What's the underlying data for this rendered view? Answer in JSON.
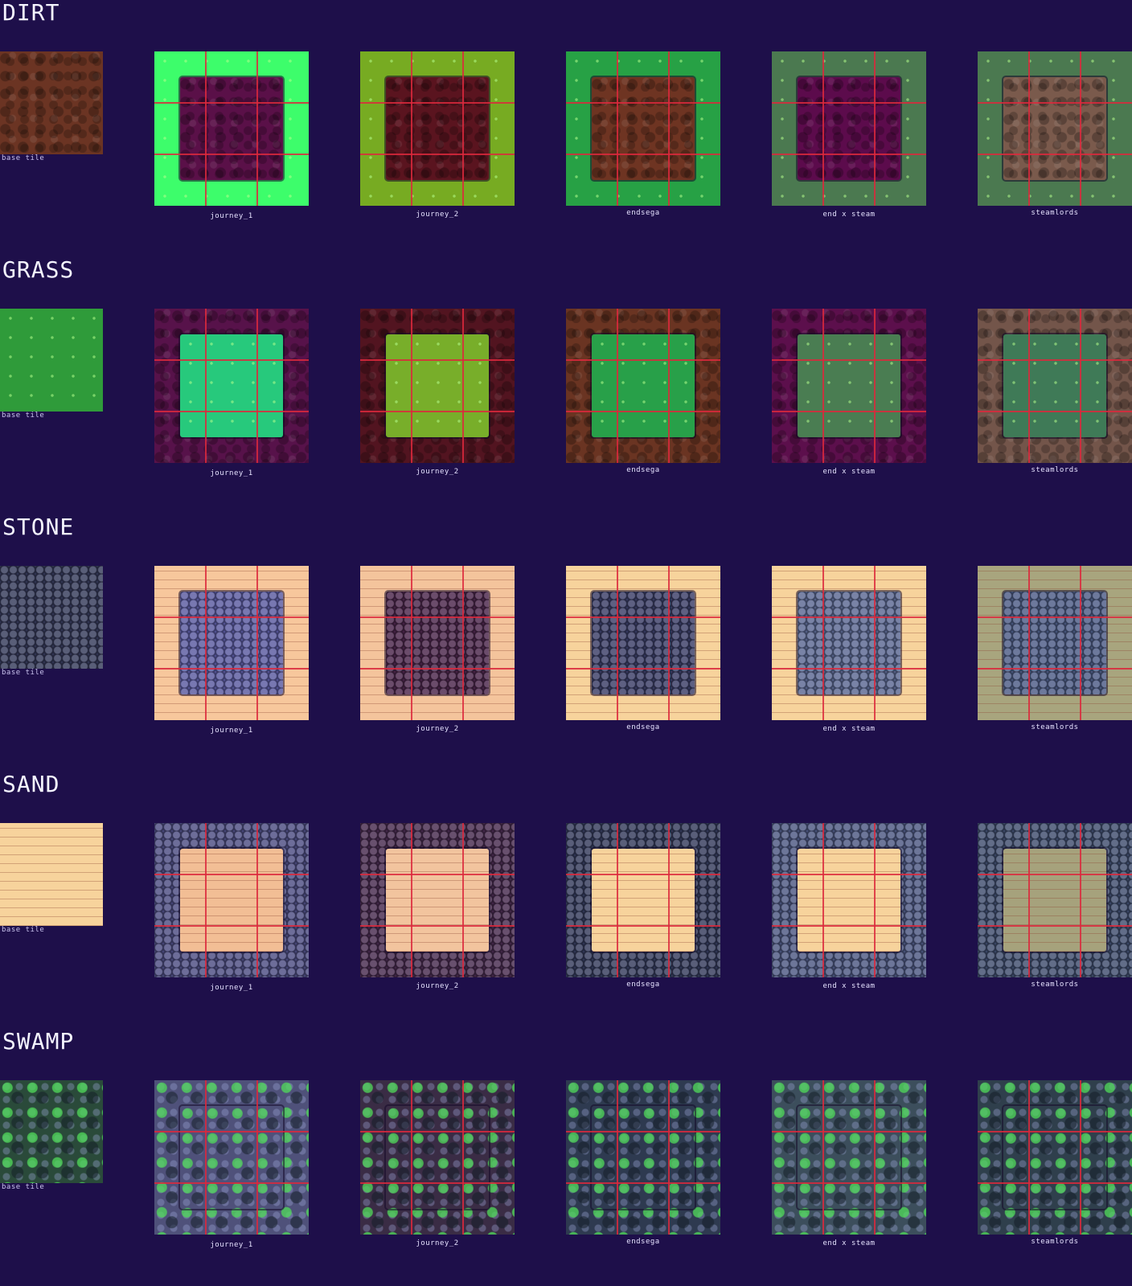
{
  "sections": [
    {
      "title": "DIRT",
      "base_label": "base tile",
      "base": {
        "fill": "#6b3423",
        "texture": "dirt"
      },
      "variants": [
        {
          "label": "journey_1",
          "outer": "#3dfd6b",
          "outer_tex": "grass",
          "inner": "#5a1048",
          "inner_tex": "dirt"
        },
        {
          "label": "journey_2",
          "outer": "#77ab22",
          "outer_tex": "grass",
          "inner": "#5a141f",
          "inner_tex": "dirt"
        },
        {
          "label": "endsega",
          "outer": "#27a145",
          "outer_tex": "grass",
          "inner": "#6e3422",
          "inner_tex": "dirt"
        },
        {
          "label": "end x steam",
          "outer": "#4b7950",
          "outer_tex": "grass",
          "inner": "#5c0b4c",
          "inner_tex": "dirt"
        },
        {
          "label": "steamlords",
          "outer": "#4b7950",
          "outer_tex": "grass",
          "inner": "#7a5a4c",
          "inner_tex": "dirt"
        }
      ]
    },
    {
      "title": "GRASS",
      "base_label": "base tile",
      "base": {
        "fill": "#2f9b3a",
        "texture": "grass"
      },
      "variants": [
        {
          "label": "journey_1",
          "outer": "#57124a",
          "outer_tex": "dirt",
          "inner": "#27c97c",
          "inner_tex": "grass"
        },
        {
          "label": "journey_2",
          "outer": "#521420",
          "outer_tex": "dirt",
          "inner": "#78ae2a",
          "inner_tex": "grass"
        },
        {
          "label": "endsega",
          "outer": "#6a3422",
          "outer_tex": "dirt",
          "inner": "#28a049",
          "inner_tex": "grass"
        },
        {
          "label": "end x steam",
          "outer": "#5c0f4c",
          "outer_tex": "dirt",
          "inner": "#4a7d52",
          "inner_tex": "grass"
        },
        {
          "label": "steamlords",
          "outer": "#73554a",
          "outer_tex": "dirt",
          "inner": "#3f7a57",
          "inner_tex": "grass"
        }
      ]
    },
    {
      "title": "STONE",
      "base_label": "base tile",
      "base": {
        "fill": "#353a5a",
        "texture": "stone"
      },
      "variants": [
        {
          "label": "journey_1",
          "outer": "#f7c79c",
          "outer_tex": "sand",
          "inner": "#5a5aa0",
          "inner_tex": "stone"
        },
        {
          "label": "journey_2",
          "outer": "#f4c49c",
          "outer_tex": "sand",
          "inner": "#4a254a",
          "inner_tex": "stone"
        },
        {
          "label": "endsega",
          "outer": "#f7d39c",
          "outer_tex": "sand",
          "inner": "#3a3d66",
          "inner_tex": "stone"
        },
        {
          "label": "end x steam",
          "outer": "#f7d39c",
          "outer_tex": "sand",
          "inner": "#5b6892",
          "inner_tex": "stone"
        },
        {
          "label": "steamlords",
          "outer": "#a8a57e",
          "outer_tex": "sand",
          "inner": "#4d5c86",
          "inner_tex": "stone"
        }
      ]
    },
    {
      "title": "SAND",
      "base_label": "base tile",
      "base": {
        "fill": "#f7d39c",
        "texture": "sand"
      },
      "variants": [
        {
          "label": "journey_1",
          "outer": "#4d4d82",
          "outer_tex": "stone",
          "inner": "#f2be95",
          "inner_tex": "sand"
        },
        {
          "label": "journey_2",
          "outer": "#472a4e",
          "outer_tex": "stone",
          "inner": "#f2c49e",
          "inner_tex": "sand"
        },
        {
          "label": "endsega",
          "outer": "#343b5c",
          "outer_tex": "stone",
          "inner": "#f7d39c",
          "inner_tex": "sand"
        },
        {
          "label": "end x steam",
          "outer": "#4d5882",
          "outer_tex": "stone",
          "inner": "#f7d39c",
          "inner_tex": "sand"
        },
        {
          "label": "steamlords",
          "outer": "#3f4d6e",
          "outer_tex": "stone",
          "inner": "#a6a27c",
          "inner_tex": "sand"
        }
      ]
    },
    {
      "title": "SWAMP",
      "base_label": "base tile",
      "base": {
        "fill": "#2a4a3a",
        "texture": "swamp"
      },
      "variants": [
        {
          "label": "journey_1",
          "outer": "#4f517a",
          "outer_tex": "swamp",
          "inner": "#4f517a",
          "inner_tex": "swamp"
        },
        {
          "label": "journey_2",
          "outer": "#3a2c45",
          "outer_tex": "swamp",
          "inner": "#3a2c45",
          "inner_tex": "swamp"
        },
        {
          "label": "endsega",
          "outer": "#2e3a50",
          "outer_tex": "swamp",
          "inner": "#2e3a50",
          "inner_tex": "swamp"
        },
        {
          "label": "end x steam",
          "outer": "#3c4e5c",
          "outer_tex": "swamp",
          "inner": "#3c4e5c",
          "inner_tex": "swamp"
        },
        {
          "label": "steamlords",
          "outer": "#2f3f4c",
          "outer_tex": "swamp",
          "inner": "#2f3f4c",
          "inner_tex": "swamp"
        }
      ]
    }
  ]
}
